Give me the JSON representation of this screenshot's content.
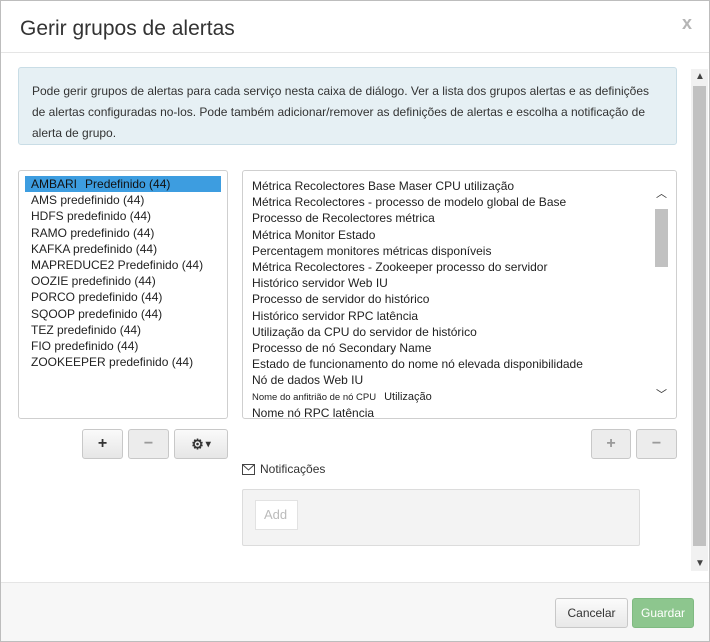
{
  "dialog": {
    "title": "Gerir grupos de alertas",
    "close_glyph": "x",
    "info_text": "Pode gerir grupos de alertas para cada serviço nesta caixa de diálogo. Ver a lista dos grupos alertas e as definições de alertas configuradas no-los. Pode também adicionar/remover as definições de alertas e escolha a notificação de alerta de grupo."
  },
  "groups": [
    {
      "name": "AMBARI",
      "badge": "Predefinido (44)",
      "selected": true
    },
    {
      "name": "AMS predefinido (44)",
      "badge": ""
    },
    {
      "name": "HDFS predefinido (44)",
      "badge": ""
    },
    {
      "name": "RAMO predefinido (44)",
      "badge": ""
    },
    {
      "name": "KAFKA predefinido (44)",
      "badge": ""
    },
    {
      "name": "MAPREDUCE2 Predefinido (44)",
      "badge": ""
    },
    {
      "name": "OOZIE predefinido (44)",
      "badge": ""
    },
    {
      "name": "PORCO predefinido (44)",
      "badge": ""
    },
    {
      "name": "SQOOP predefinido (44)",
      "badge": ""
    },
    {
      "name": "TEZ predefinido (44)",
      "badge": ""
    },
    {
      "name": "FIO predefinido (44)",
      "badge": ""
    },
    {
      "name": "ZOOKEEPER predefinido (44)",
      "badge": ""
    }
  ],
  "definitions": [
    "Métrica Recolectores Base Maser CPU utilização",
    "Métrica Recolectores - processo de modelo global de Base",
    "Processo de Recolectores métrica",
    "Métrica Monitor Estado",
    "Percentagem monitores métricas disponíveis",
    "Métrica Recolectores - Zookeeper processo do servidor",
    "Histórico servidor Web IU",
    "Processo de servidor do histórico",
    "Histórico servidor RPC latência",
    "Utilização da CPU do servidor de histórico",
    "Processo de nó Secondary Name",
    "Estado de funcionamento do nome nó elevada disponibilidade",
    "Nó de dados Web IU",
    "Nome do anfitrião de nó CPU|Utilização",
    "Nome nó RPC latência"
  ],
  "group_buttons": {
    "add": "+",
    "remove": "−",
    "settings_icon": "gear-icon",
    "settings_caret": "▾"
  },
  "def_buttons": {
    "add": "+",
    "remove": "−"
  },
  "notifications": {
    "label": "Notificações",
    "icon": "envelope-icon",
    "add_placeholder": "Add"
  },
  "footer": {
    "cancel": "Cancelar",
    "save": "Guardar"
  },
  "colors": {
    "selected": "#3d9de0",
    "info_bg": "#e6f0f4",
    "save_bg": "#8dc68e"
  }
}
